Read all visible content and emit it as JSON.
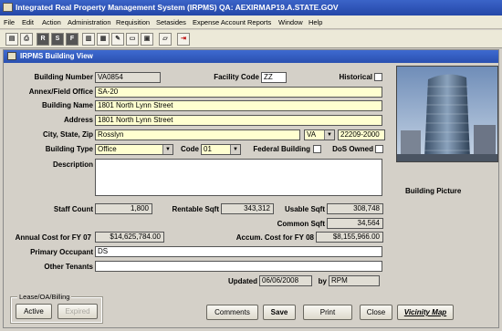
{
  "app": {
    "title": "Integrated Real Property Management System (IRPMS)   QA: AEXIRMAP19.A.STATE.GOV"
  },
  "menu": [
    "File",
    "Edit",
    "Action",
    "Administration",
    "Requisition",
    "Setasides",
    "Expense Account",
    "Reports",
    "Window",
    "Help"
  ],
  "toolbar": {
    "icons": [
      "save-icon",
      "print-icon",
      "r-icon",
      "s-icon",
      "f-icon",
      "building-icon",
      "building-alt-icon",
      "tool-icon",
      "document-icon",
      "grid-icon",
      "folder-icon",
      "exit-icon"
    ],
    "letters": {
      "r": "R",
      "s": "S",
      "f": "F"
    }
  },
  "window": {
    "title": "IRPMS Building View"
  },
  "form": {
    "building_number_label": "Building Number",
    "building_number": "VA0854",
    "facility_code_label": "Facility Code",
    "facility_code": "ZZ",
    "historical_label": "Historical",
    "annex_label": "Annex/Field Office",
    "annex": "SA-20",
    "building_name_label": "Building Name",
    "building_name": "1801 North Lynn Street",
    "address_label": "Address",
    "address": "1801 North Lynn Street",
    "city_label": "City, State, Zip",
    "city": "Rosslyn",
    "state": "VA",
    "zip": "22209-2000",
    "building_type_label": "Building Type",
    "building_type": "Office",
    "code_label": "Code",
    "code": "01",
    "federal_building_label": "Federal Building",
    "dos_owned_label": "DoS Owned",
    "description_label": "Description",
    "description": "",
    "staff_count_label": "Staff Count",
    "staff_count": "1,800",
    "rentable_label": "Rentable Sqft",
    "rentable": "343,312",
    "usable_label": "Usable Sqft",
    "usable": "308,748",
    "common_label": "Common Sqft",
    "common": "34,564",
    "annual_cost_label": "Annual Cost for FY 07",
    "annual_cost": "$14,625,784.00",
    "accum_cost_label": "Accum. Cost for FY 08",
    "accum_cost": "$8,155,966.00",
    "primary_label": "Primary Occupant",
    "primary": "DS",
    "other_label": "Other Tenants",
    "other": "",
    "updated_label": "Updated",
    "updated": "06/06/2008",
    "by_label": "by",
    "by": "RPM",
    "picture_label": "Building Picture"
  },
  "lease_group": {
    "label": "Lease/OA/Billing",
    "active": "Active",
    "expired": "Expired"
  },
  "buttons": {
    "comments": "Comments",
    "save": "Save",
    "print": "Print",
    "close": "Close",
    "vicinity": "Vicinity Map"
  }
}
